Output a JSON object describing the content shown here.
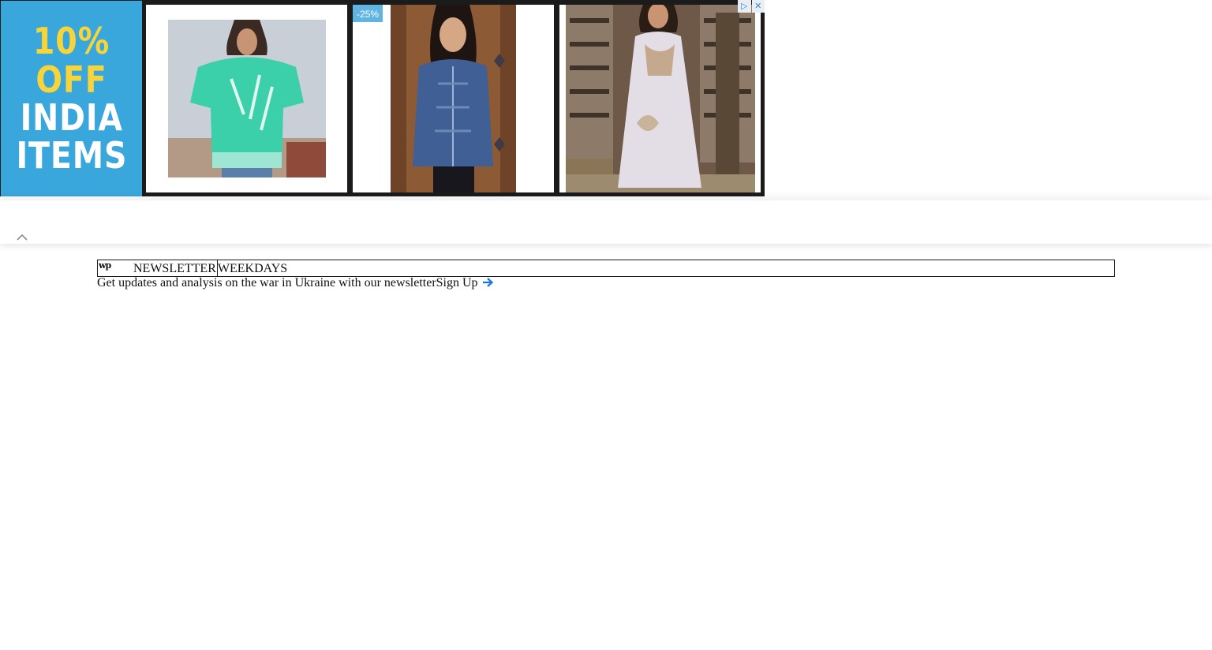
{
  "ad": {
    "promo_lines": [
      "10% OFF",
      "INDIA",
      "ITEMS"
    ],
    "discount_badge": "-25%",
    "adchoices_icon": "adchoices-icon",
    "close_icon": "close-icon",
    "colors": {
      "promo_background": "#39a6dc",
      "promo_highlight": "#f7d43a",
      "badge": "#5fb4e2"
    }
  },
  "sticky_bar": {
    "collapse_icon": "chevron-up-icon"
  },
  "newsletter": {
    "logo": "wp",
    "label": "NEWSLETTER",
    "frequency": "WEEKDAYS",
    "description": "Get updates and analysis on the war in Ukraine with our newsletter",
    "signup_label": "Sign Up",
    "arrow_icon": "arrow-right-icon",
    "colors": {
      "arrow": "#1a73e8"
    }
  }
}
